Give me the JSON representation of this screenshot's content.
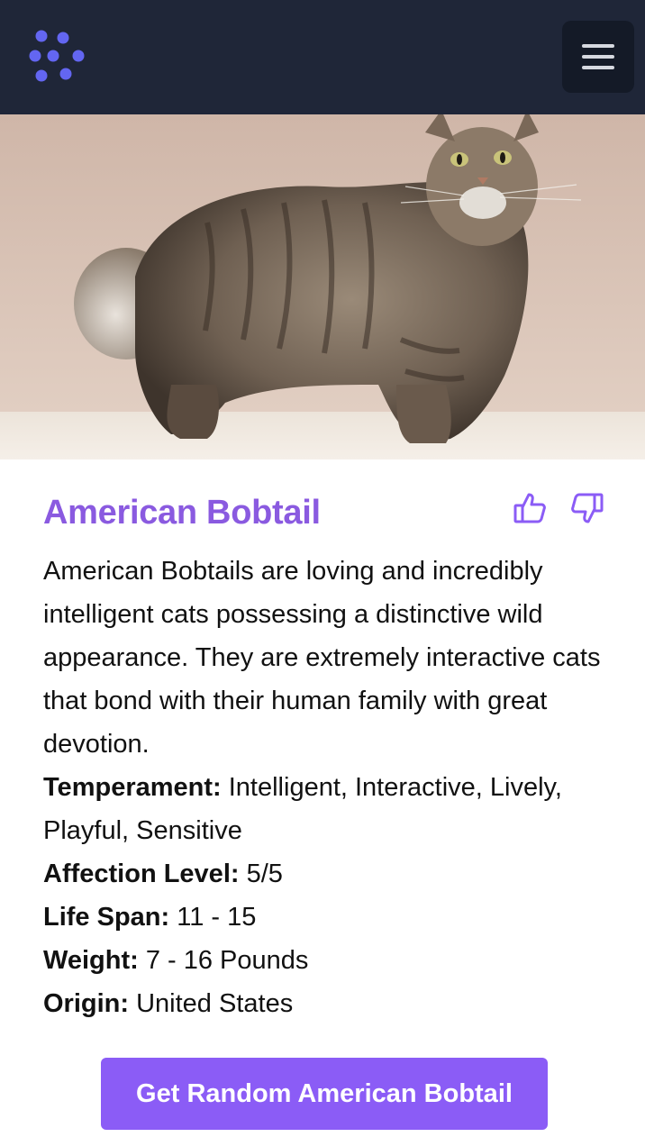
{
  "navbar": {
    "logo_icon": "dots-logo-icon",
    "menu_icon": "hamburger-menu-icon",
    "accent": "#5b5bd6"
  },
  "breed": {
    "name": "American Bobtail",
    "image_alt": "American Bobtail cat",
    "description": "American Bobtails are loving and incredibly intelligent cats possessing a distinctive wild appearance. They are extremely interactive cats that bond with their human family with great devotion.",
    "temperament_label": "Temperament:",
    "temperament_value": " Intelligent, Interactive, Lively, Playful, Sensitive",
    "affection_label": "Affection Level:",
    "affection_value": " 5/5",
    "lifespan_label": "Life Span:",
    "lifespan_value": " 11 - 15",
    "weight_label": "Weight:",
    "weight_value": " 7 - 16 Pounds",
    "origin_label": "Origin:",
    "origin_value": " United States"
  },
  "actions": {
    "thumbs_up_icon": "thumbs-up-icon",
    "thumbs_down_icon": "thumbs-down-icon",
    "random_button_label": "Get Random American Bobtail"
  },
  "colors": {
    "navbar_bg": "#1f2638",
    "title_purple": "#8a5ae0",
    "button_purple": "#8b5cf6"
  }
}
